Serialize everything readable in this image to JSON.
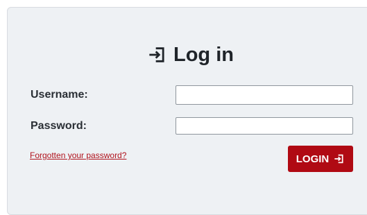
{
  "form": {
    "title": "Log in",
    "title_icon": "login-icon",
    "username_label": "Username:",
    "username_value": "",
    "password_label": "Password:",
    "password_value": "",
    "forgot_link": "Forgotten your password?",
    "login_button": "LOGIN",
    "login_button_icon": "login-icon"
  },
  "colors": {
    "panel_background": "#eef1f4",
    "accent": "#b00a13",
    "link": "#b0121c",
    "text": "#1f2429"
  }
}
